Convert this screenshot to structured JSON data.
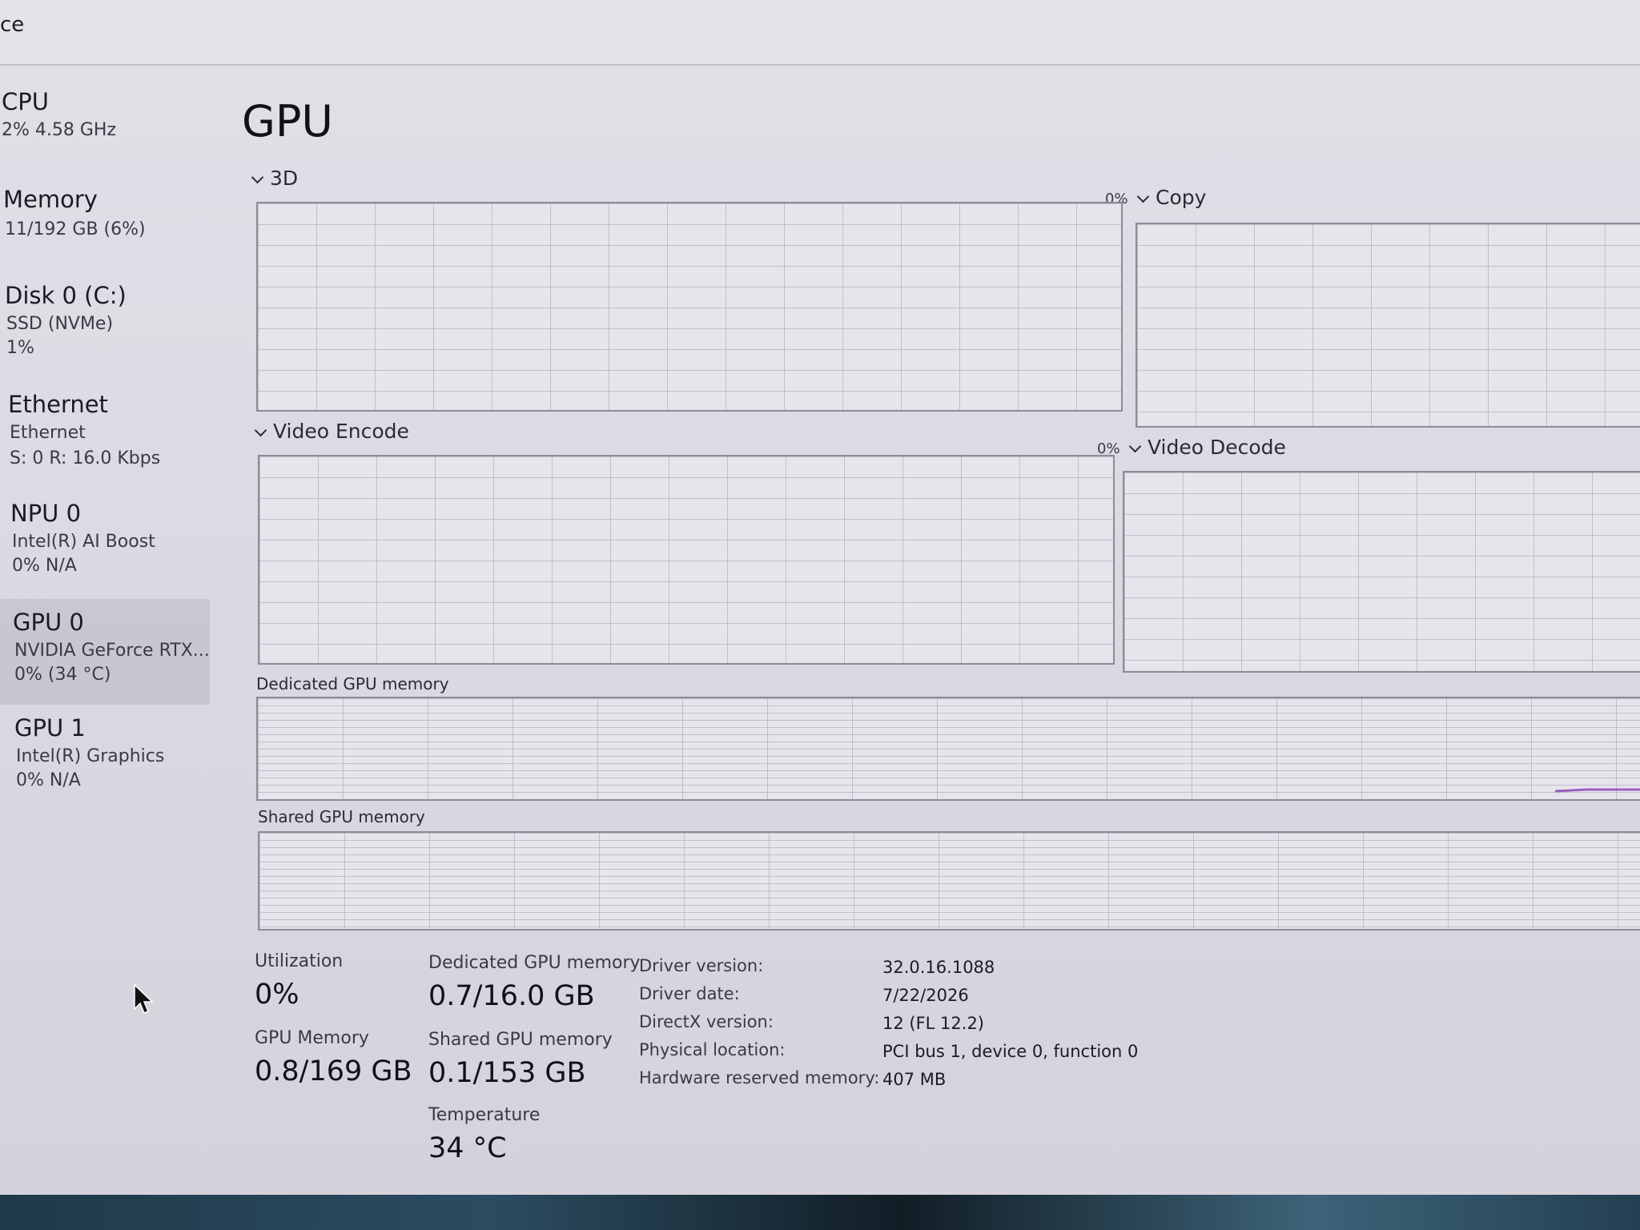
{
  "window": {
    "title_fragment": "ce"
  },
  "sidebar": {
    "items": [
      {
        "name": "CPU",
        "line1": "2% 4.58 GHz",
        "line2": "",
        "active": false
      },
      {
        "name": "Memory",
        "line1": "11/192 GB (6%)",
        "line2": "",
        "active": false
      },
      {
        "name": "Disk 0 (C:)",
        "line1": "SSD (NVMe)",
        "line2": "1%",
        "active": false
      },
      {
        "name": "Ethernet",
        "line1": "Ethernet",
        "line2": "S: 0 R: 16.0 Kbps",
        "active": false
      },
      {
        "name": "NPU 0",
        "line1": "Intel(R) AI Boost",
        "line2": "0% N/A",
        "active": false
      },
      {
        "name": "GPU 0",
        "line1": "NVIDIA GeForce RTX...",
        "line2": "0% (34 °C)",
        "active": true
      },
      {
        "name": "GPU 1",
        "line1": "Intel(R) Graphics",
        "line2": "0% N/A",
        "active": false
      }
    ]
  },
  "main": {
    "title": "GPU",
    "engines": [
      {
        "label": "3D",
        "percent": "0%"
      },
      {
        "label": "Copy",
        "percent": ""
      },
      {
        "label": "Video Encode",
        "percent": "0%"
      },
      {
        "label": "Video Decode",
        "percent": ""
      }
    ],
    "memory_graphs": {
      "dedicated_label": "Dedicated GPU memory",
      "shared_label": "Shared GPU memory"
    }
  },
  "stats": {
    "utilization_label": "Utilization",
    "utilization_value": "0%",
    "dedicated_label": "Dedicated GPU memory",
    "dedicated_value": "0.7/16.0 GB",
    "gpu_memory_label": "GPU Memory",
    "gpu_memory_value": "0.8/169 GB",
    "shared_label": "Shared GPU memory",
    "shared_value": "0.1/153 GB",
    "temperature_label": "Temperature",
    "temperature_value": "34 °C"
  },
  "info": [
    {
      "key": "Driver version:",
      "value": "32.0.16.1088"
    },
    {
      "key": "Driver date:",
      "value": "7/22/2026"
    },
    {
      "key": "DirectX version:",
      "value": "12 (FL 12.2)"
    },
    {
      "key": "Physical location:",
      "value": "PCI bus 1, device 0, function 0"
    },
    {
      "key": "Hardware reserved memory:",
      "value": "407 MB"
    }
  ],
  "colors": {
    "background": "#dcd8e2",
    "graph_border": "#8e8a98",
    "graph_line": "#9b5fc0",
    "selected_item": "#b4b0be"
  },
  "icons": {
    "cursor": "mouse-pointer-icon"
  }
}
